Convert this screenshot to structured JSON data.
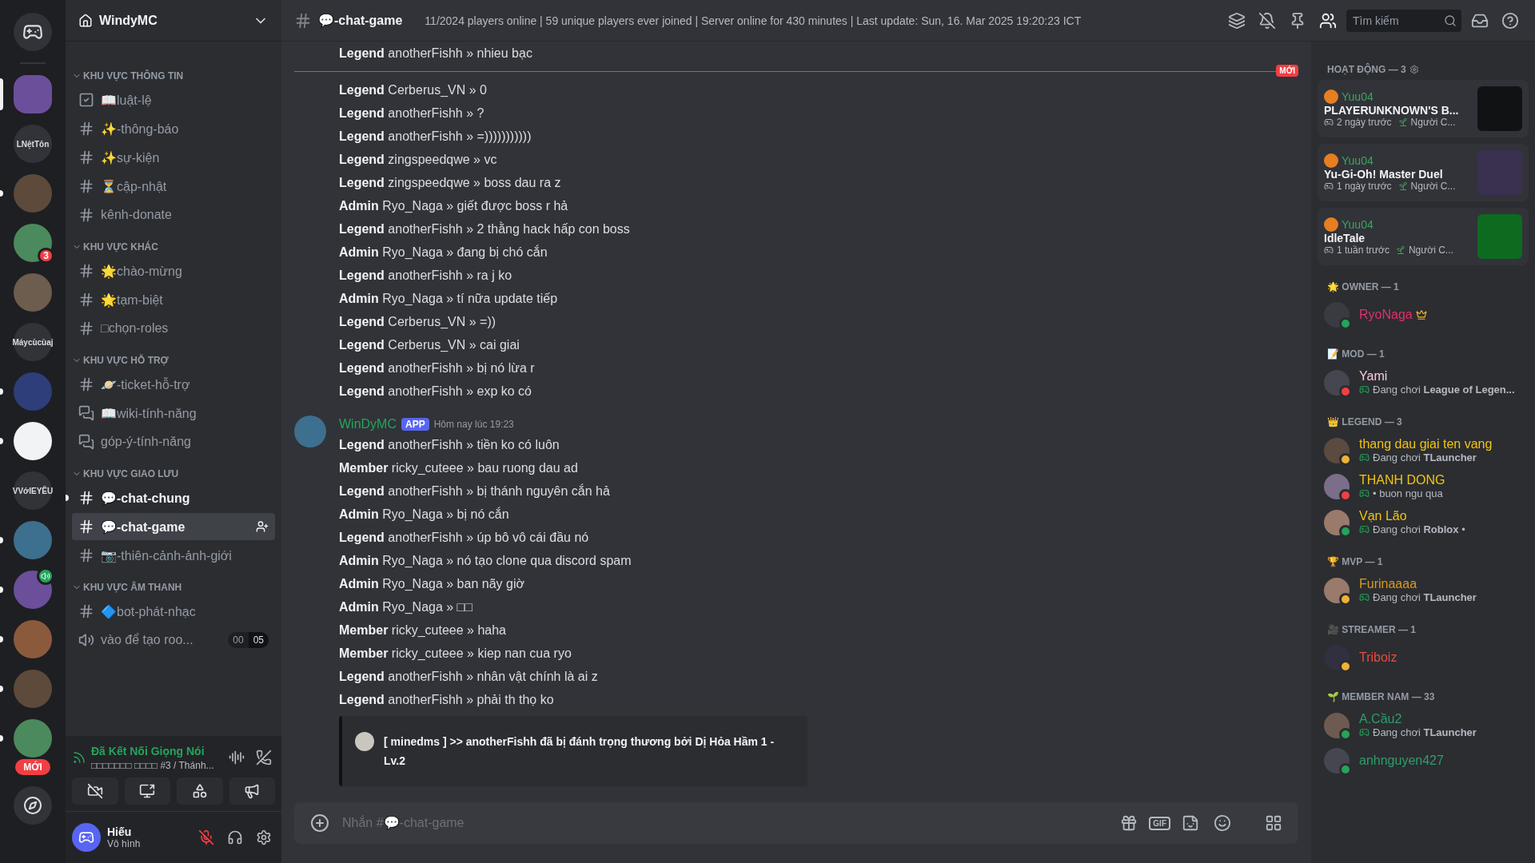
{
  "servers": [
    {
      "kind": "home",
      "selected": false,
      "unread": false
    },
    {
      "kind": "image",
      "selected": true,
      "unread": false
    },
    {
      "kind": "text",
      "label": "LNệtTôn",
      "selected": false,
      "unread": false
    },
    {
      "kind": "image",
      "selected": false,
      "unread": true
    },
    {
      "kind": "image",
      "selected": false,
      "unread": false,
      "badge": "3"
    },
    {
      "kind": "image",
      "selected": false,
      "unread": false
    },
    {
      "kind": "text",
      "label": "Máycùcùaj",
      "selected": false,
      "unread": false
    },
    {
      "kind": "image",
      "selected": false,
      "unread": true
    },
    {
      "kind": "image",
      "selected": false,
      "unread": true
    },
    {
      "kind": "text",
      "label": "VVớIEYÊU",
      "selected": false,
      "unread": false
    },
    {
      "kind": "image",
      "selected": false,
      "unread": true
    },
    {
      "kind": "image",
      "selected": false,
      "unread": true,
      "speaking": true
    },
    {
      "kind": "image",
      "selected": false,
      "unread": true
    },
    {
      "kind": "image",
      "selected": false,
      "unread": true
    },
    {
      "kind": "image",
      "selected": false,
      "unread": true,
      "badge": "MỚI"
    },
    {
      "kind": "explore",
      "selected": false,
      "unread": false
    }
  ],
  "server_name": "WindyMC",
  "categories": [
    {
      "name": "KHU VỰC THÔNG TIN",
      "channels": [
        {
          "kind": "rules",
          "name": "📖luật-lệ",
          "selected": false,
          "unread": false
        },
        {
          "kind": "text",
          "name": "✨-thông-báo",
          "selected": false,
          "unread": false
        },
        {
          "kind": "text",
          "name": "✨sự-kiện",
          "selected": false,
          "unread": false
        },
        {
          "kind": "text",
          "name": "⏳cập-nhật",
          "selected": false,
          "unread": false
        },
        {
          "kind": "text",
          "name": "kênh-donate",
          "selected": false,
          "unread": false
        }
      ]
    },
    {
      "name": "KHU VỰC KHÁC",
      "channels": [
        {
          "kind": "text",
          "name": "🌟chào-mừng",
          "selected": false,
          "unread": false
        },
        {
          "kind": "text",
          "name": "🌟tạm-biệt",
          "selected": false,
          "unread": false
        },
        {
          "kind": "text",
          "name": "□chọn-roles",
          "selected": false,
          "unread": false
        }
      ]
    },
    {
      "name": "KHU VỰC HỖ TRỢ",
      "channels": [
        {
          "kind": "text",
          "name": "🪐-ticket-hỗ-trợ",
          "selected": false,
          "unread": false
        },
        {
          "kind": "forum",
          "name": "📖wiki-tính-năng",
          "selected": false,
          "unread": false
        },
        {
          "kind": "forum",
          "name": "góp-ý-tính-năng",
          "selected": false,
          "unread": false
        }
      ]
    },
    {
      "name": "KHU VỰC GIAO LƯU",
      "channels": [
        {
          "kind": "text",
          "name": "💬-chat-chung",
          "selected": false,
          "unread": true
        },
        {
          "kind": "text",
          "name": "💬-chat-game",
          "selected": true,
          "unread": false
        },
        {
          "kind": "text",
          "name": "📷-thiên-cảnh-ảnh-giới",
          "selected": false,
          "unread": false
        }
      ]
    },
    {
      "name": "KHU VỰC ÂM THANH",
      "channels": [
        {
          "kind": "text",
          "name": "🔷bot-phát-nhạc",
          "selected": false,
          "unread": false
        },
        {
          "kind": "voice",
          "name": "vào để tạo roo...",
          "selected": false,
          "unread": false,
          "users": "00",
          "limit": "05"
        }
      ]
    }
  ],
  "voice_panel": {
    "status": "Đã Kết Nối Giọng Nói",
    "channel": "□□□□□□□ □□□□ #3 / Thánh..."
  },
  "user_panel": {
    "name": "Hiếu",
    "status": "Vô hình",
    "muted": true
  },
  "top_bar": {
    "channel": "💬-chat-game",
    "topic": "11/2024 players online | 59 unique players ever joined | Server online for 430 minutes | Last update: Sun, 16. Mar 2025 19:20:23 ICT",
    "search_placeholder": "Tìm kiếm"
  },
  "chat": {
    "earlier_lines": [
      "**Legend** anotherFishh » nhieu bạc"
    ],
    "new_label": "MỚI",
    "lines": [
      "**Legend** Cerberus_VN » 0",
      "**Legend** anotherFishh » ?",
      "**Legend** anotherFishh » =)))))))))))",
      "**Legend** zingspeedqwe » vc",
      "**Legend** zingspeedqwe » boss dau ra z",
      "**Admin** Ryo_Naga » giết được boss r hả",
      "**Legend** anotherFishh » 2 thằng hack hấp con boss",
      "**Admin** Ryo_Naga » đang bị chó cắn",
      "**Legend** anotherFishh » ra j ko",
      "**Admin** Ryo_Naga » tí nữa update tiếp",
      "**Legend** Cerberus_VN » =))",
      "**Legend** Cerberus_VN » cai giai",
      "**Legend** anotherFishh » bị nó lừa r",
      "**Legend** anotherFishh » exp ko có"
    ],
    "message": {
      "author": "WinDyMC",
      "tag": "APP",
      "time": "Hôm nay lúc 19:23",
      "lines": [
        "**Legend** anotherFishh » tiền ko có luôn",
        "**Member** ricky_cuteee » bau ruong dau ad",
        "**Legend** anotherFishh » bị thánh nguyên cắn hả",
        "**Admin** Ryo_Naga » bị nó cắn",
        "**Legend** anotherFishh » úp bô vô cái đầu nó",
        "**Admin** Ryo_Naga » nó tạo clone qua discord spam",
        "**Admin** Ryo_Naga » ban nãy giờ",
        "**Admin** Ryo_Naga » □□",
        "**Member** ricky_cuteee » haha",
        "**Member** ricky_cuteee » kiep nan cua ryo",
        "**Legend** anotherFishh » nhân vật chính là ai z",
        "**Legend** anotherFishh » phải th thọ ko"
      ],
      "embed": "[ minedms ] >> anotherFishh đã bị đánh trọng thương bởi Dị Hỏa Hầm 1 - Lv.2"
    },
    "placeholder": "Nhắn #💬-chat-game",
    "gif_label": "GIF"
  },
  "member_list": {
    "activity_title": "HOẠT ĐỘNG — 3",
    "activities": [
      {
        "user": "Yuu04",
        "game": "PLAYERUNKNOWN'S B...",
        "time": "2 ngày trước",
        "extra": "Người C..."
      },
      {
        "user": "Yuu04",
        "game": "Yu-Gi-Oh! Master Duel",
        "time": "1 ngày trước",
        "extra": "Người C..."
      },
      {
        "user": "Yuu04",
        "game": "IdleTale",
        "time": "1 tuần trước",
        "extra": "Người C..."
      }
    ],
    "groups": [
      {
        "title": "🌟 OWNER — 1",
        "members": [
          {
            "name": "RyoNaga",
            "color": "#e0306a",
            "status": {
              "color": "#23a55a"
            },
            "owner": true
          }
        ]
      },
      {
        "title": "📝 MOD — 1",
        "members": [
          {
            "name": "Yami",
            "color": "#f9c8e0",
            "status": {
              "color": "#f23f43"
            },
            "owner": false,
            "activity": "Đang chơi **League of Legen...**"
          }
        ]
      },
      {
        "title": "👑 LEGEND — 3",
        "members": [
          {
            "name": "thang dau giai ten vang",
            "color": "#f1c40f",
            "status": {
              "color": "#f0b232"
            },
            "owner": false,
            "activity": "Đang chơi **TLauncher**"
          },
          {
            "name": "THANH DONG",
            "color": "#f1c40f",
            "status": {
              "color": "#f23f43"
            },
            "owner": false,
            "activity": "• buon ngu qua"
          },
          {
            "name": "Vạn Lão",
            "color": "#f1c40f",
            "status": {
              "color": "#23a55a"
            },
            "owner": false,
            "activity": "Đang chơi **Roblox** •"
          }
        ]
      },
      {
        "title": "🏆 MVP — 1",
        "members": [
          {
            "name": "Furinaaaa",
            "color": "#d99a1e",
            "status": {
              "color": "#f0b232"
            },
            "owner": false,
            "activity": "Đang chơi **TLauncher**"
          }
        ]
      },
      {
        "title": "🎥 STREAMER — 1",
        "members": [
          {
            "name": "Triboiz",
            "color": "#e74c3c",
            "status": {
              "color": "#f0b232"
            },
            "owner": false
          }
        ]
      },
      {
        "title": "🌱 MEMBER NAM — 33",
        "members": [
          {
            "name": "A.Cầu2",
            "color": "#2e9e6a",
            "status": {
              "color": "#23a55a"
            },
            "owner": false,
            "activity": "Đang chơi **TLauncher**"
          },
          {
            "name": "anhnguyen427",
            "color": "#2e9e6a",
            "status": {
              "color": "#23a55a"
            },
            "owner": false
          }
        ]
      }
    ]
  }
}
